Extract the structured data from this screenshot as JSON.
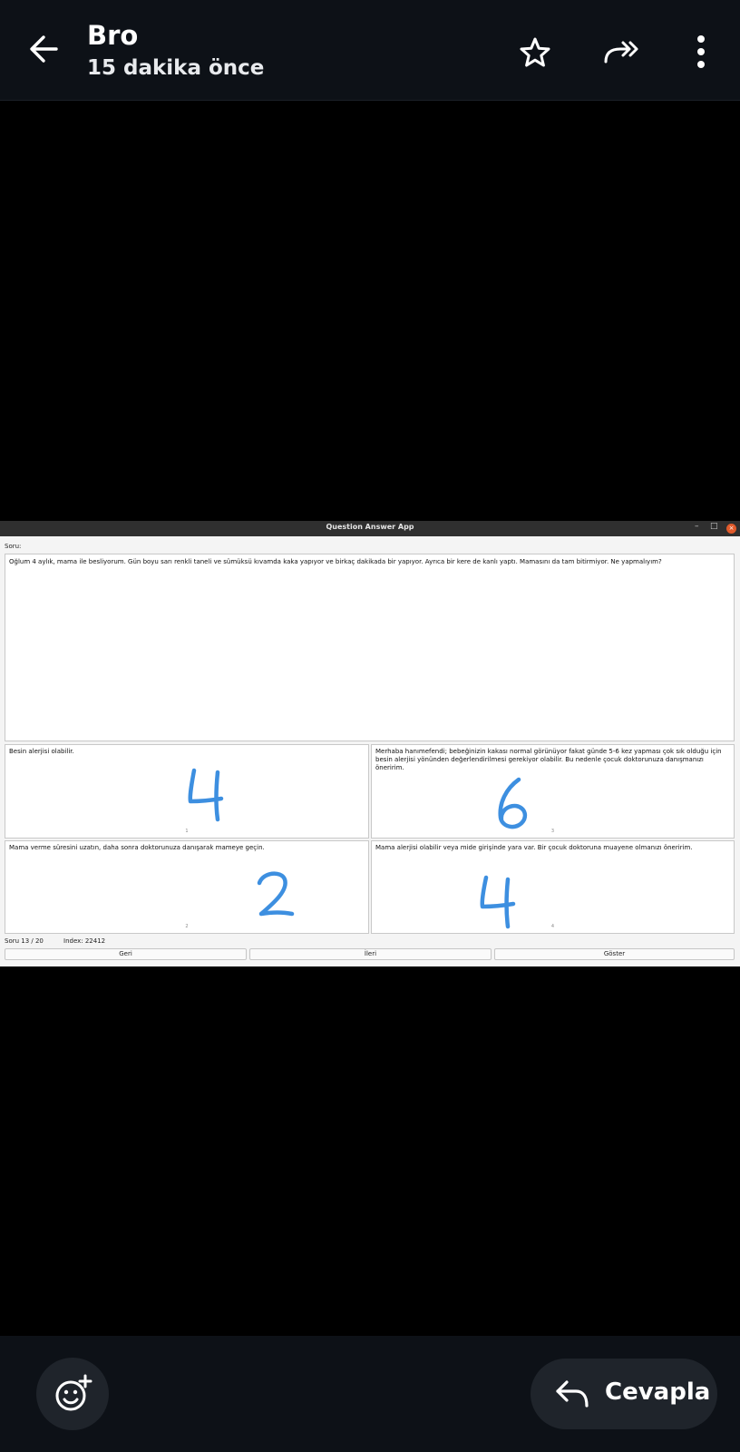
{
  "header": {
    "title": "Bro",
    "subtitle": "15 dakika önce",
    "back_icon": "arrow-left-icon",
    "star_icon": "star-outline-icon",
    "forward_icon": "forward-all-icon",
    "more_icon": "more-vertical-icon"
  },
  "screenshot": {
    "window_title": "Question Answer App",
    "window_controls": {
      "minimize": "–",
      "maximize": "□",
      "close": "×"
    },
    "question_label": "Soru:",
    "question_text": "Oğlum 4 aylık, mama ile besliyorum. Gün boyu sarı renkli taneli ve sümüksü kıvamda kaka yapıyor ve birkaç dakikada bir yapıyor. Ayrıca bir kere de kanlı yaptı. Mamasını da tam bitirmiyor. Ne yapmalıyım?",
    "answers": [
      {
        "text": "Besin alerjisi olabilir.",
        "number": "1",
        "handwritten_score": "4"
      },
      {
        "text": "Merhaba hanımefendi; bebeğinizin kakası normal görünüyor fakat günde 5-6 kez yapması çok sık olduğu için besin alerjisi yönünden değerlendirilmesi gerekiyor olabilir. Bu nedenle çocuk doktorunuza danışmanızı öneririm.",
        "number": "3",
        "handwritten_score": "6"
      },
      {
        "text": "Mama verme süresini uzatın, daha sonra doktorunuza danışarak mameye geçin.",
        "number": "2",
        "handwritten_score": "2"
      },
      {
        "text": "Mama alerjisi olabilir veya mide girişinde yara var. Bir çocuk doktoruna muayene olmanızı öneririm.",
        "number": "4",
        "handwritten_score": "4"
      }
    ],
    "status_progress": "Soru 13 / 20",
    "status_index": "Index: 22412",
    "buttons": {
      "back": "Geri",
      "next": "İleri",
      "show": "Göster"
    },
    "handwriting_color": "#3d8fe0"
  },
  "footer": {
    "emoji_icon": "add-reaction-icon",
    "reply_icon": "reply-icon",
    "reply_label": "Cevapla"
  }
}
